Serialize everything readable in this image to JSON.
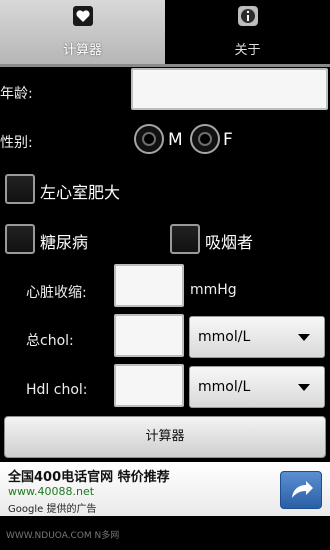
{
  "tabs": [
    {
      "label": "计算器",
      "icon": "heart-icon",
      "selected": true
    },
    {
      "label": "关于",
      "icon": "info-icon",
      "selected": false
    }
  ],
  "form": {
    "age_label": "年龄:",
    "age_value": "",
    "gender_label": "性别:",
    "gender_options": [
      "M",
      "F"
    ],
    "lvh_label": "左心室肥大",
    "diabetes_label": "糖尿病",
    "smoker_label": "吸烟者",
    "systolic_label": "心脏收缩:",
    "systolic_unit": "mmHg",
    "systolic_value": "",
    "total_chol_label": "总chol:",
    "total_chol_value": "",
    "total_chol_unit_selected": "mmol/L",
    "hdl_chol_label": "Hdl chol:",
    "hdl_chol_value": "",
    "hdl_chol_unit_selected": "mmol/L",
    "calculate_button": "计算器"
  },
  "ad": {
    "title": "全国400电话官网 特价推荐",
    "url": "www.40088.net",
    "credit": "Google 提供的广告",
    "arrow_icon": "arrow-icon"
  },
  "watermark": "WWW.NDUOA.COM N多网",
  "colors": {
    "background": "#000000",
    "tab_selected": "#c4c4c4",
    "ad_url": "#1e7b22",
    "ad_button": "#2a5fa6"
  }
}
